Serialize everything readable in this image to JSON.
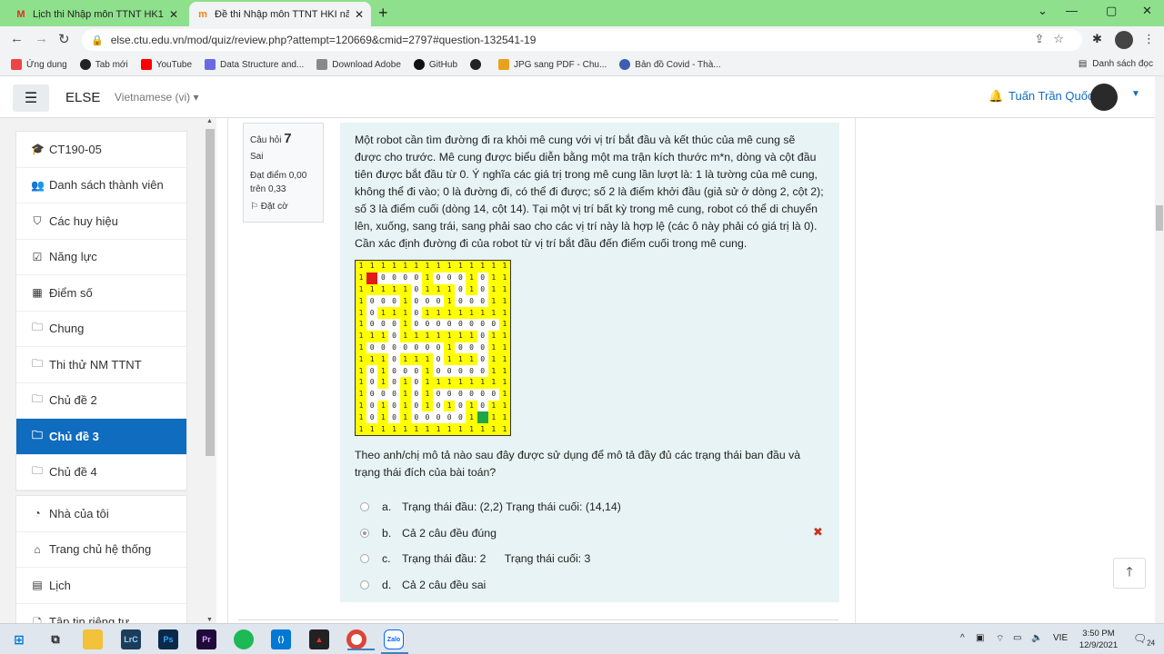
{
  "browser": {
    "tabs": [
      {
        "title": "Lịch thi Nhập môn TTNT HK1 202",
        "icon": "gmail-icon"
      },
      {
        "title": "Đề thi Nhập môn TTNT HKI năm",
        "icon": "moodle-icon"
      }
    ],
    "url": "else.ctu.edu.vn/mod/quiz/review.php?attempt=120669&cmid=2797#question-132541-19",
    "bookmarks": [
      {
        "label": "Ứng dung",
        "color": "#e44"
      },
      {
        "label": "Tab mới",
        "color": "#222"
      },
      {
        "label": "YouTube",
        "color": "#f00"
      },
      {
        "label": "Data Structure and...",
        "color": "#6b6be0"
      },
      {
        "label": "Download Adobe",
        "color": "#888"
      },
      {
        "label": "GitHub",
        "color": "#111"
      },
      {
        "label": "",
        "color": "#222"
      },
      {
        "label": "JPG sang PDF - Chu...",
        "color": "#e8a21c"
      },
      {
        "label": "Bản đồ Covid - Thà...",
        "color": "#3a5fb0"
      }
    ],
    "reading_list": "Danh sách đọc"
  },
  "header": {
    "brand": "ELSE",
    "language": "Vietnamese (vi)",
    "user_name": "Tuấn Trần Quốc"
  },
  "nav": {
    "group1": [
      {
        "label": "CT190-05",
        "icon": "graduation-cap-icon",
        "glyph": "🎓"
      },
      {
        "label": "Danh sách thành viên",
        "icon": "users-icon",
        "glyph": "👥"
      },
      {
        "label": "Các huy hiệu",
        "icon": "shield-icon",
        "glyph": "⛉"
      },
      {
        "label": "Năng lực",
        "icon": "checkbox-icon",
        "glyph": "☑"
      },
      {
        "label": "Điểm số",
        "icon": "table-icon",
        "glyph": "▦"
      },
      {
        "label": "Chung",
        "icon": "folder-icon",
        "glyph": "🗀"
      },
      {
        "label": "Thi thử NM TTNT",
        "icon": "folder-icon",
        "glyph": "🗀"
      },
      {
        "label": "Chủ đề 2",
        "icon": "folder-icon",
        "glyph": "🗀"
      },
      {
        "label": "Chủ đề 3",
        "icon": "folder-icon",
        "glyph": "🗀",
        "active": true
      },
      {
        "label": "Chủ đề 4",
        "icon": "folder-icon",
        "glyph": "🗀"
      }
    ],
    "group2": [
      {
        "label": "Nhà của tôi",
        "icon": "dashboard-icon",
        "glyph": "◔"
      },
      {
        "label": "Trang chủ hệ thống",
        "icon": "home-icon",
        "glyph": "⌂"
      },
      {
        "label": "Lịch",
        "icon": "calendar-icon",
        "glyph": "▤"
      },
      {
        "label": "Tập tin riêng tư",
        "icon": "file-icon",
        "glyph": "🗋"
      }
    ]
  },
  "question": {
    "label": "Câu hỏi",
    "number": "7",
    "status": "Sai",
    "grade": "Đạt điểm 0,00 trên 0,33",
    "flag": "Đặt cờ",
    "text": "Một robot cần tìm đường đi ra khỏi mê cung với vị trí bắt đầu và kết thúc của mê cung sẽ được cho trước. Mê cung được biểu diễn bằng một ma trận kích thước m*n, dòng và cột đầu tiên được bắt đầu từ 0. Ý nghĩa các giá trị trong mê cung lần lượt là: 1 là tường của mê cung, không thể đi vào; 0 là đường đi, có thể đi được; số 2 là điểm khởi đầu (giả sử ở dòng 2, cột 2); số 3 là điểm cuối (dòng 14, cột 14). Tại một vị trí bất kỳ trong mê cung, robot có thể di chuyển lên, xuống, sang trái, sang phải sao cho các vị trí này là hợp lệ (các ô này phải có giá trị là 0). Cần xác định đường đi của robot từ vị trí bắt đầu đến điểm cuối trong mê cung.",
    "subtext": "Theo anh/chị mô tả nào sau đây được sử dụng để mô tả đầy đủ các trạng thái ban đầu và trạng thái đích của bài toán?",
    "answers": [
      {
        "letter": "a.",
        "text": "Trạng thái đầu: (2,2) Trạng thái cuối: (14,14)",
        "selected": false,
        "wrong": false
      },
      {
        "letter": "b.",
        "text": "Cả 2 câu đều đúng",
        "selected": true,
        "wrong": true
      },
      {
        "letter": "c.",
        "text": "Trạng thái đầu: 2      Trạng thái cuối: 3",
        "selected": false,
        "wrong": false
      },
      {
        "letter": "d.",
        "text": "Cả 2 câu đều sai",
        "selected": false,
        "wrong": false
      }
    ],
    "maze": [
      "11111111111111",
      "1S000010001011",
      "11111011101011",
      "10001000100011",
      "10111011111111",
      "10001000000001",
      "11101111111011",
      "10000000100011",
      "11101110111011",
      "10100010000011",
      "10101011111111",
      "10001010000001",
      "10101010101011",
      "10101000001E11",
      "11111111111111"
    ]
  },
  "taskbar": {
    "language": "VIE",
    "time": "3:50 PM",
    "date": "12/9/2021",
    "notifications": "24"
  }
}
